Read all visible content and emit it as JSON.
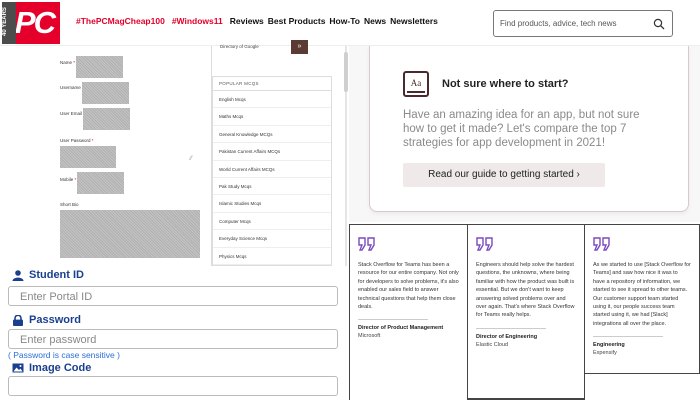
{
  "pcmag": {
    "logo": "PC",
    "logo_badge": "40 YEARS",
    "trending": [
      "#ThePCMagCheap100",
      "#Windows11"
    ],
    "nav": [
      "Reviews",
      "Best Products",
      "How-To",
      "News",
      "Newsletters"
    ],
    "search_placeholder": "Find products, advice, tech news"
  },
  "signup_form": {
    "fields": [
      {
        "label": "Name",
        "required": true
      },
      {
        "label": "Username",
        "required": true
      },
      {
        "label": "User Email",
        "required": true
      },
      {
        "label": "User Password",
        "required": true
      },
      {
        "label": "Mobile",
        "required": true
      },
      {
        "label": "Short Bio",
        "required": false
      }
    ],
    "side_top_label": "Directory of Google",
    "side_top_button": "»",
    "side_heading": "POPULAR MCQS",
    "side_items": [
      "English Mcqs",
      "Maths Mcqs",
      "General Knowledge MCQs",
      "Pakistan Current Affairs MCQs",
      "World Current Affairs MCQs",
      "Pak Study Mcqs",
      "Islamic Studies Mcqs",
      "Computer Mcqs",
      "Everyday Science Mcqs",
      "Physics Mcqs"
    ]
  },
  "login": {
    "student_id_label": "Student ID",
    "student_id_placeholder": "Enter Portal ID",
    "password_label": "Password",
    "password_placeholder": "Enter password",
    "password_hint": "( Password is case sensitive )",
    "image_code_label": "Image Code",
    "image_code_value": "",
    "accent": "#1a3f8f"
  },
  "guide_card": {
    "icon_text": "Aa",
    "title": "Not sure where to start?",
    "body": "Have an amazing idea for an app, but not sure how to get it made? Let's compare the top 7 strategies for app development in 2021!",
    "button": "Read our guide to getting started ›"
  },
  "testimonials": [
    {
      "text": "Stack Overflow for Teams has been a resource for our entire company. Not only for developers to solve problems, it's also enabled our sales field to answer technical questions that help them close deals.",
      "role": "Director of Product Management",
      "company": "Microsoft"
    },
    {
      "text": "Engineers should help solve the hardest questions, the unknowns, where being familiar with how the product was built is essential. But we don't want to keep answering solved problems over and over again. That's where Stack Overflow for Teams really helps.",
      "role": "Director of Engineering",
      "company": "Elastic Cloud"
    },
    {
      "text": "As we started to use [Stack Overflow for Teams] and saw how nice it was to have a repository of information, we started to see it spread to other teams. Our customer support team started using it, our people success team started using it, we had [Slack] integrations all over the place.",
      "role": "Engineering",
      "company": "Expensify"
    }
  ],
  "colors": {
    "pcmag_red": "#e4002b",
    "quote_purple": "#7a4bbd"
  }
}
